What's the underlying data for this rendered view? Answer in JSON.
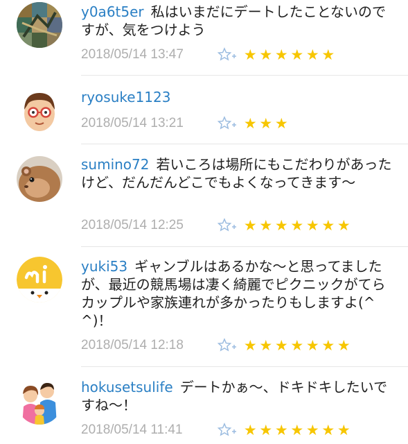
{
  "colors": {
    "username": "#2a7fc4",
    "timestamp": "#aeaeae",
    "star": "#f7c600",
    "add_star_icon": "#9bbce0"
  },
  "comments": [
    {
      "username": "y0a6t5er",
      "text": "私はいまだにデートしたことないのですが、気をつけよう",
      "timestamp": "2018/05/14 13:47",
      "star_count": 6,
      "avatar_icon": "mosaic-avatar-icon"
    },
    {
      "username": "ryosuke1123",
      "text": "",
      "timestamp": "2018/05/14 13:21",
      "star_count": 3,
      "avatar_icon": "glasses-face-avatar-icon"
    },
    {
      "username": "sumino72",
      "text": "若いころは場所にもこだわりがあったけど、だんだんどこでもよくなってきます〜",
      "timestamp": "2018/05/14 12:25",
      "star_count": 7,
      "avatar_icon": "hamster-avatar-icon"
    },
    {
      "username": "yuki53",
      "text": "ギャンブルはあるかな〜と思ってましたが、最近の競馬場は凄く綺麗でピクニックがてらカップルや家族連れが多かったりもしますよ(^^)！",
      "timestamp": "2018/05/14 12:18",
      "star_count": 7,
      "avatar_icon": "mi-chick-avatar-icon"
    },
    {
      "username": "hokusetsulife",
      "text": "デートかぁ〜、ドキドキしたいですね〜！",
      "timestamp": "2018/05/14 11:41",
      "star_count": 7,
      "avatar_icon": "family-avatar-icon"
    }
  ]
}
